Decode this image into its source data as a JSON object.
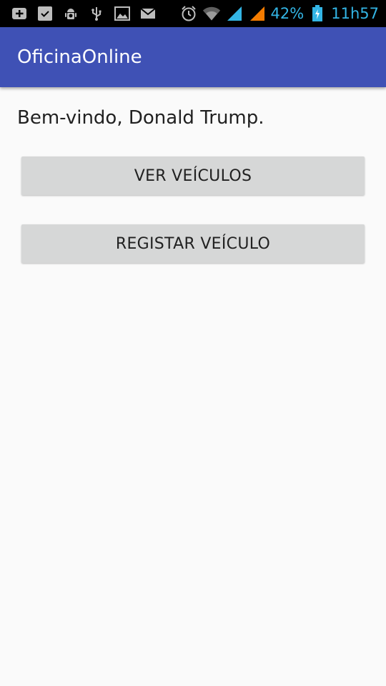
{
  "status_bar": {
    "left_icons": [
      "add-notification-icon",
      "checkbox-icon",
      "android-debug-icon",
      "usb-icon",
      "image-icon",
      "mail-icon"
    ],
    "right_icons": [
      "alarm-icon",
      "wifi-icon",
      "signal-icon",
      "signal-icon-2",
      "battery-charging-icon"
    ],
    "battery": "42%",
    "time": "11h57",
    "accent_color": "#33b5e5"
  },
  "app_bar": {
    "title": "OficinaOnline",
    "color": "#3f51b5"
  },
  "main": {
    "welcome_text": "Bem-vindo, Donald Trump.",
    "buttons": {
      "view_vehicles": "VER VEÍCULOS",
      "register_vehicle": "REGISTAR VEÍCULO"
    }
  }
}
